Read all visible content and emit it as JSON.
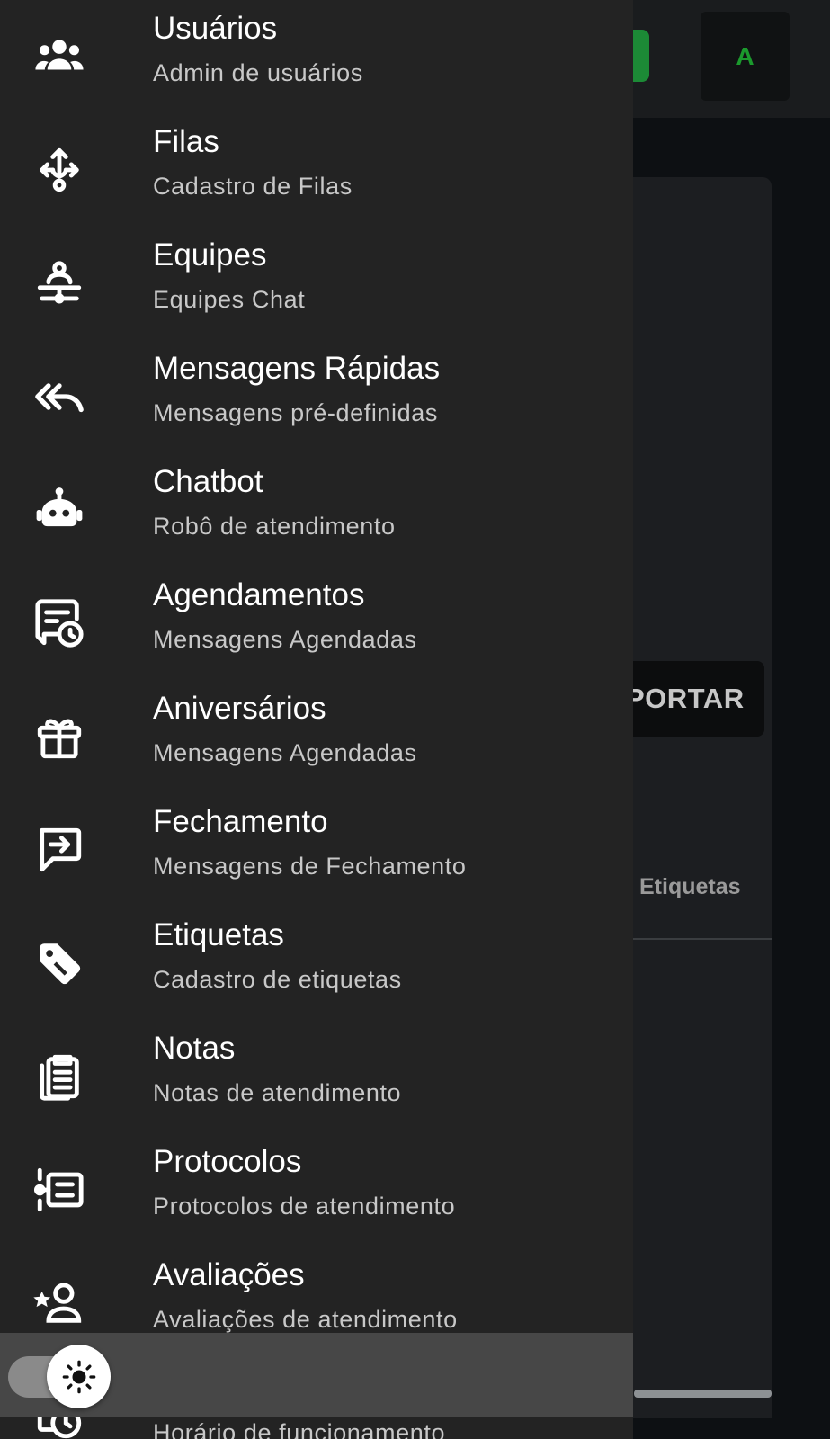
{
  "background": {
    "avatar_initial": "A",
    "import_button_label": "PORTAR",
    "tab_label": "Etiquetas"
  },
  "menu": {
    "items": [
      {
        "icon": "users-icon",
        "title": "Usuários",
        "subtitle": "Admin de usuários"
      },
      {
        "icon": "queue-split-icon",
        "title": "Filas",
        "subtitle": "Cadastro de Filas"
      },
      {
        "icon": "team-icon",
        "title": "Equipes",
        "subtitle": "Equipes Chat"
      },
      {
        "icon": "reply-all-icon",
        "title": "Mensagens Rápidas",
        "subtitle": "Mensagens pré-definidas"
      },
      {
        "icon": "robot-icon",
        "title": "Chatbot",
        "subtitle": "Robô de atendimento"
      },
      {
        "icon": "scheduled-message-icon",
        "title": "Agendamentos",
        "subtitle": "Mensagens Agendadas"
      },
      {
        "icon": "gift-icon",
        "title": "Aniversários",
        "subtitle": "Mensagens Agendadas"
      },
      {
        "icon": "message-arrow-icon",
        "title": "Fechamento",
        "subtitle": "Mensagens de Fechamento"
      },
      {
        "icon": "tag-icon",
        "title": "Etiquetas",
        "subtitle": "Cadastro de etiquetas"
      },
      {
        "icon": "clipboard-icon",
        "title": "Notas",
        "subtitle": "Notas de atendimento"
      },
      {
        "icon": "protocol-list-icon",
        "title": "Protocolos",
        "subtitle": "Protocolos de atendimento"
      },
      {
        "icon": "rating-user-icon",
        "title": "Avaliações",
        "subtitle": "Avaliações de atendimento"
      },
      {
        "icon": "clock-icon",
        "title": "",
        "subtitle": "Horário de funcionamento"
      }
    ]
  },
  "theme_toggle": {
    "icon": "sun-icon"
  }
}
